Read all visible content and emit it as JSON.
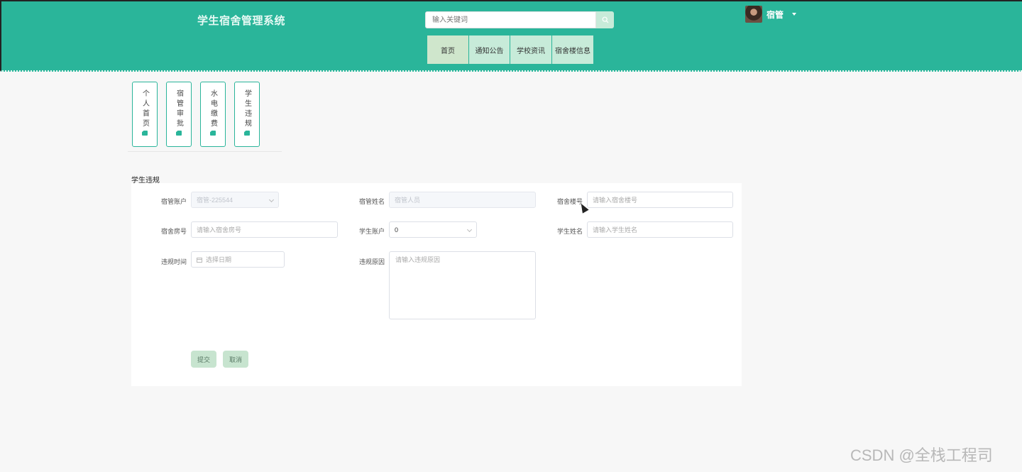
{
  "header": {
    "title": "学生宿舍管理系统",
    "search": {
      "placeholder": "输入关键词"
    },
    "user": {
      "name": "宿管"
    },
    "nav": [
      {
        "label": "首页"
      },
      {
        "label": "通知公告"
      },
      {
        "label": "学校资讯"
      },
      {
        "label": "宿舍楼信息"
      }
    ]
  },
  "sidebar": {
    "tabs": [
      {
        "label": "个人首页"
      },
      {
        "label": "宿管审批"
      },
      {
        "label": "水电缴费"
      },
      {
        "label": "学生违规"
      }
    ]
  },
  "page": {
    "section_title": "学生违规"
  },
  "form": {
    "dorm_account": {
      "label": "宿管账户",
      "value": "宿管-225544"
    },
    "dorm_name": {
      "label": "宿管姓名",
      "placeholder": "宿管人员"
    },
    "building_no": {
      "label": "宿舍楼号",
      "placeholder": "请输入宿舍楼号"
    },
    "room_no": {
      "label": "宿舍房号",
      "placeholder": "请输入宿舍房号"
    },
    "student_account": {
      "label": "学生账户",
      "value": "0"
    },
    "student_name": {
      "label": "学生姓名",
      "placeholder": "请输入学生姓名"
    },
    "violation_time": {
      "label": "违规时间",
      "placeholder": "选择日期"
    },
    "violation_reason": {
      "label": "违规原因",
      "placeholder": "请输入违规原因"
    },
    "submit_label": "提交",
    "cancel_label": "取消"
  },
  "watermark": "CSDN @全栈工程司",
  "colors": {
    "header_bg": "#2ab59a",
    "button_bg": "#c7e4cf",
    "nav_bg": "#c7ebd9"
  }
}
